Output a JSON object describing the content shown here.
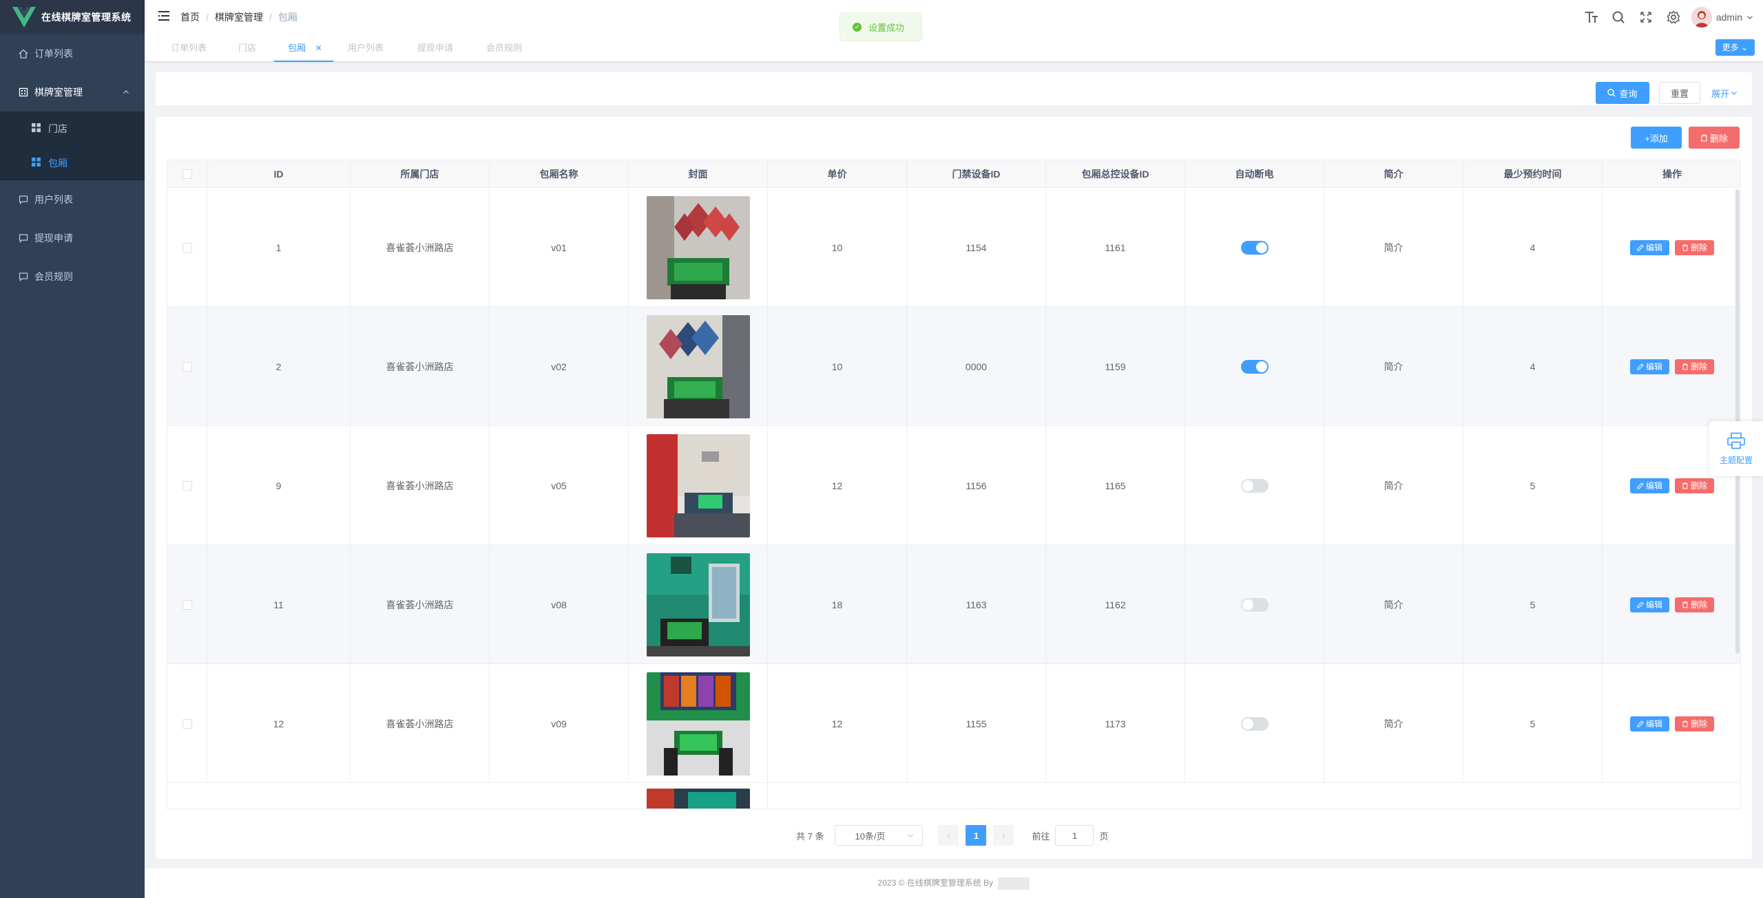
{
  "app": {
    "title": "在线棋牌室管理系统"
  },
  "sidebar": {
    "items": [
      {
        "label": "订单列表",
        "icon": "home-icon"
      },
      {
        "label": "棋牌室管理",
        "icon": "building-icon"
      },
      {
        "label": "用户列表",
        "icon": "message-icon"
      },
      {
        "label": "提现申请",
        "icon": "message-icon"
      },
      {
        "label": "会员规则",
        "icon": "message-icon"
      }
    ],
    "sub_items": [
      {
        "label": "门店"
      },
      {
        "label": "包厢"
      }
    ]
  },
  "breadcrumb": {
    "home": "首页",
    "parent": "棋牌室管理",
    "current": "包厢"
  },
  "header": {
    "user": "admin"
  },
  "tags": {
    "items": [
      "订单列表",
      "门店",
      "包厢",
      "用户列表",
      "提现申请",
      "会员规则"
    ],
    "more": "更多"
  },
  "toast": {
    "message": "设置成功"
  },
  "search": {
    "query": "查询",
    "reset": "重置",
    "expand": "展开"
  },
  "toolbar": {
    "add": "+添加",
    "delete": "删除"
  },
  "table": {
    "headers": [
      "ID",
      "所属门店",
      "包厢名称",
      "封面",
      "单价",
      "门禁设备ID",
      "包厢总控设备ID",
      "自动断电",
      "简介",
      "最少预约时间",
      "操作"
    ],
    "rows": [
      {
        "id": "1",
        "store": "喜雀荟小洲路店",
        "name": "v01",
        "price": "10",
        "door": "1154",
        "ctrl": "1161",
        "auto": true,
        "intro": "简介",
        "min": "4"
      },
      {
        "id": "2",
        "store": "喜雀荟小洲路店",
        "name": "v02",
        "price": "10",
        "door": "0000",
        "ctrl": "1159",
        "auto": true,
        "intro": "简介",
        "min": "4"
      },
      {
        "id": "9",
        "store": "喜雀荟小洲路店",
        "name": "v05",
        "price": "12",
        "door": "1156",
        "ctrl": "1165",
        "auto": false,
        "intro": "简介",
        "min": "5"
      },
      {
        "id": "11",
        "store": "喜雀荟小洲路店",
        "name": "v08",
        "price": "18",
        "door": "1163",
        "ctrl": "1162",
        "auto": false,
        "intro": "简介",
        "min": "5"
      },
      {
        "id": "12",
        "store": "喜雀荟小洲路店",
        "name": "v09",
        "price": "12",
        "door": "1155",
        "ctrl": "1173",
        "auto": false,
        "intro": "简介",
        "min": "5"
      }
    ],
    "edit": "编辑",
    "delete": "删除"
  },
  "pagination": {
    "total": "共 7 条",
    "size": "10条/页",
    "page": "1",
    "goto": "前往",
    "page_unit": "页",
    "jump_value": "1"
  },
  "theme": {
    "label": "主题配置"
  },
  "footer": {
    "text": "2023 © 在线棋牌室管理系统 By"
  }
}
